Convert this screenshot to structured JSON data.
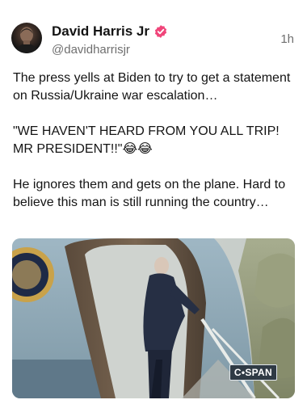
{
  "author": {
    "display_name": "David Harris Jr",
    "handle": "@davidharrisjr",
    "verified": true,
    "avatar_icon": "avatar-portrait-icon",
    "verified_icon": "verified-badge-icon",
    "verified_color": "#f0457a"
  },
  "post": {
    "timestamp": "1h",
    "paragraphs": [
      "The press yells at Biden to try to get a statement on Russia/Ukraine war escalation…",
      "\"WE HAVEN'T HEARD FROM YOU ALL TRIP! MR PRESIDENT!!\"😂😂",
      "He ignores them and gets on the plane. Hard to believe this man is still running the country…"
    ]
  },
  "media": {
    "type": "video-still",
    "network_logo": "C•SPAN"
  }
}
